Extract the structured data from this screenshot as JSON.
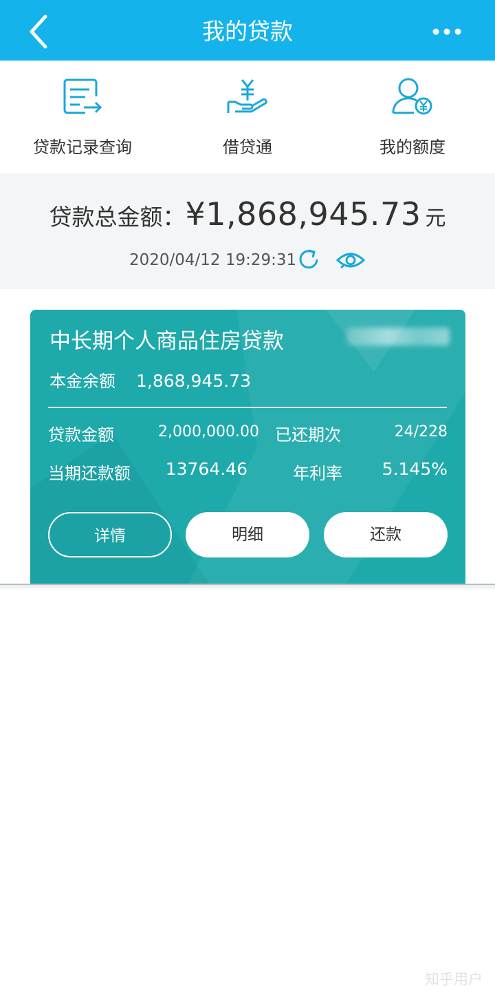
{
  "header": {
    "title": "我的贷款",
    "back_icon": "chevron-left-icon",
    "more_icon": "more-dots-icon",
    "background": "#14b3ec"
  },
  "quick_menu": [
    {
      "label": "贷款记录查询",
      "icon": "document-export-icon"
    },
    {
      "label": "借贷通",
      "icon": "hand-yuan-icon"
    },
    {
      "label": "我的额度",
      "icon": "user-yuan-icon"
    }
  ],
  "summary": {
    "total_label": "贷款总金额：",
    "total_amount": "¥1,868,945.73",
    "total_unit": "元",
    "timestamp": "2020/04/12 19:29:31",
    "refresh_icon": "refresh-icon",
    "eye_icon": "eye-icon"
  },
  "loan_card": {
    "title": "中长期个人商品住房贷款",
    "principal_label": "本金余额",
    "principal_value": "1,868,945.73",
    "stats": {
      "loan_amount_label": "贷款金额",
      "loan_amount_value": "2,000,000.00",
      "paid_periods_label": "已还期次",
      "paid_periods_value": "24/228",
      "current_payment_label": "当期还款额",
      "current_payment_value": "13764.46",
      "annual_rate_label": "年利率",
      "annual_rate_value": "5.145%"
    },
    "buttons": {
      "details": "详情",
      "breakdown": "明细",
      "repay": "还款"
    },
    "color": "#1ea9ab"
  },
  "watermark": "知乎用户"
}
